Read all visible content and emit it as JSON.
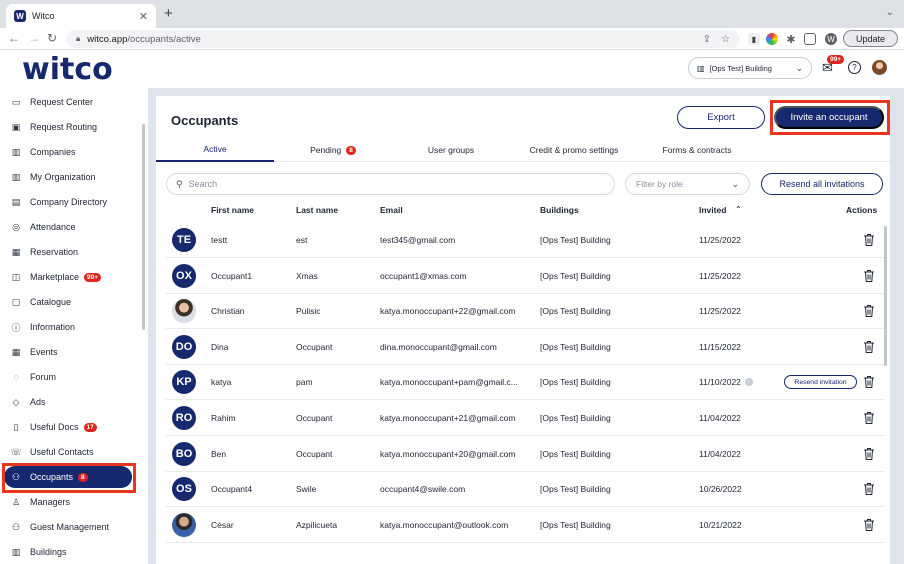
{
  "browser": {
    "tab_title": "Witco",
    "url_host": "witco.app",
    "url_path": "/occupants/active",
    "update_label": "Update",
    "profile_initial": "W"
  },
  "header": {
    "logo": "witco",
    "building_select": "[Ops Test] Building",
    "mail_badge": "99+"
  },
  "sidebar": {
    "items": [
      {
        "label": "Request Center",
        "icon": "inbox-icon",
        "glyph": "▭"
      },
      {
        "label": "Request Routing",
        "icon": "routing-icon",
        "glyph": "▣"
      },
      {
        "label": "Companies",
        "icon": "companies-icon",
        "glyph": "▥"
      },
      {
        "label": "My Organization",
        "icon": "organization-icon",
        "glyph": "▥"
      },
      {
        "label": "Company Directory",
        "icon": "directory-icon",
        "glyph": "▤"
      },
      {
        "label": "Attendance",
        "icon": "attendance-icon",
        "glyph": "◎"
      },
      {
        "label": "Reservation",
        "icon": "calendar-icon",
        "glyph": "▦"
      },
      {
        "label": "Marketplace",
        "icon": "store-icon",
        "glyph": "◫",
        "badge": "99+"
      },
      {
        "label": "Catalogue",
        "icon": "catalogue-icon",
        "glyph": "▢"
      },
      {
        "label": "Information",
        "icon": "info-icon",
        "glyph": "ⓘ"
      },
      {
        "label": "Events",
        "icon": "events-icon",
        "glyph": "▦"
      },
      {
        "label": "Forum",
        "icon": "chat-icon",
        "glyph": "◌"
      },
      {
        "label": "Ads",
        "icon": "tag-icon",
        "glyph": "◇"
      },
      {
        "label": "Useful Docs",
        "icon": "docs-icon",
        "glyph": "▯",
        "badge": "17"
      },
      {
        "label": "Useful Contacts",
        "icon": "contacts-icon",
        "glyph": "☏"
      },
      {
        "label": "Occupants",
        "icon": "people-icon",
        "glyph": "⚇",
        "badge": "8",
        "active": true
      },
      {
        "label": "Managers",
        "icon": "user-icon",
        "glyph": "♙"
      },
      {
        "label": "Guest Management",
        "icon": "guests-icon",
        "glyph": "⚇"
      },
      {
        "label": "Buildings",
        "icon": "building-icon",
        "glyph": "▥"
      }
    ]
  },
  "main": {
    "title": "Occupants",
    "export_label": "Export",
    "invite_label": "Invite an occupant",
    "tabs": [
      {
        "label": "Active",
        "active": true
      },
      {
        "label": "Pending",
        "badge": "8"
      },
      {
        "label": "User groups"
      },
      {
        "label": "Credit & promo settings"
      },
      {
        "label": "Forms & contracts"
      }
    ],
    "search_placeholder": "Search",
    "role_placeholder": "Filter by role",
    "resend_all_label": "Resend all invitations",
    "columns": {
      "first_name": "First name",
      "last_name": "Last name",
      "email": "Email",
      "buildings": "Buildings",
      "invited": "Invited",
      "actions": "Actions"
    },
    "resend_label": "Resend invitation",
    "rows": [
      {
        "initials": "TE",
        "first": "testt",
        "last": "est",
        "email": "test345@gmail.com",
        "building": "[Ops Test] Building",
        "invited": "11/25/2022"
      },
      {
        "initials": "OX",
        "first": "Occupant1",
        "last": "Xmas",
        "email": "occupant1@xmas.com",
        "building": "[Ops Test] Building",
        "invited": "11/25/2022"
      },
      {
        "initials": "",
        "photo": "photo1",
        "first": "Christian",
        "last": "Pulisic",
        "email": "katya.monoccupant+22@gmail.com",
        "building": "[Ops Test] Building",
        "invited": "11/25/2022"
      },
      {
        "initials": "DO",
        "first": "Dina",
        "last": "Occupant",
        "email": "dina.monoccupant@gmail.com",
        "building": "[Ops Test] Building",
        "invited": "11/15/2022"
      },
      {
        "initials": "KP",
        "first": "katya",
        "last": "pam",
        "email": "katya.monoccupant+pam@gmail.c...",
        "building": "[Ops Test] Building",
        "invited": "11/10/2022",
        "pending": true
      },
      {
        "initials": "RO",
        "first": "Rahim",
        "last": "Occupant",
        "email": "katya.monoccupant+21@gmail.com",
        "building": "[Ops Test] Building",
        "invited": "11/04/2022"
      },
      {
        "initials": "BO",
        "first": "Ben",
        "last": "Occupant",
        "email": "katya.monoccupant+20@gmail.com",
        "building": "[Ops Test] Building",
        "invited": "11/04/2022"
      },
      {
        "initials": "OS",
        "first": "Occupant4",
        "last": "Swile",
        "email": "occupant4@swile.com",
        "building": "[Ops Test] Building",
        "invited": "10/26/2022"
      },
      {
        "initials": "",
        "photo": "photo2",
        "first": "César",
        "last": "Azpilicueta",
        "email": "katya.monoccupant@outlook.com",
        "building": "[Ops Test] Building",
        "invited": "10/21/2022"
      }
    ]
  },
  "colors": {
    "brand": "#16286e",
    "badge": "#e0251b",
    "highlight": "#e8371e"
  }
}
